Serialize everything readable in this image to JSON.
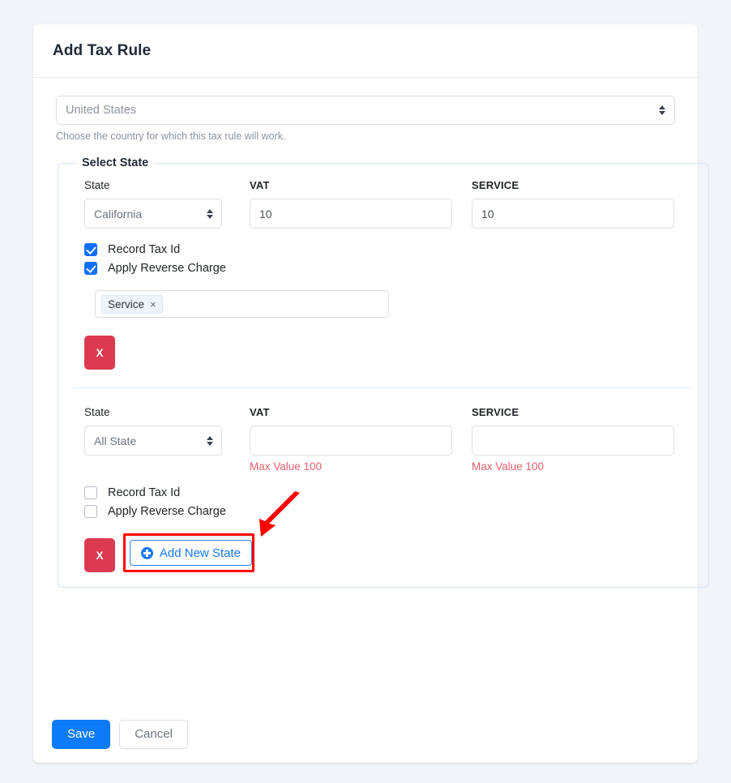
{
  "page": {
    "background_color": "#f1f5f9"
  },
  "card": {
    "title": "Add Tax Rule"
  },
  "country": {
    "selected": "United States",
    "help_text": "Choose the country for which this tax rule will work."
  },
  "fieldset": {
    "legend": "Select State"
  },
  "labels": {
    "state": "State",
    "vat": "VAT",
    "service": "SERVICE",
    "record_tax_id": "Record Tax Id",
    "apply_reverse_charge": "Apply Reverse Charge",
    "delete": "X"
  },
  "rows": [
    {
      "state": "California",
      "vat": "10",
      "service": "10",
      "vat_error": "",
      "service_error": "",
      "record_tax_id_checked": true,
      "apply_reverse_charge_checked": true,
      "tags": [
        {
          "label": "Service",
          "remove": "×"
        }
      ]
    },
    {
      "state": "All State",
      "vat": "",
      "service": "",
      "vat_error": "Max Value 100",
      "service_error": "Max Value 100",
      "record_tax_id_checked": false,
      "apply_reverse_charge_checked": false,
      "tags": []
    }
  ],
  "add_state": {
    "label": "Add New State",
    "icon": "plus-circle-icon",
    "highlight_color": "#ff0000",
    "accent_color": "#1878f2"
  },
  "footer": {
    "save_label": "Save",
    "cancel_label": "Cancel",
    "save_color": "#0d7bf7"
  },
  "annotation": {
    "arrow_color": "#ff0000",
    "points_to": "Add New State"
  }
}
